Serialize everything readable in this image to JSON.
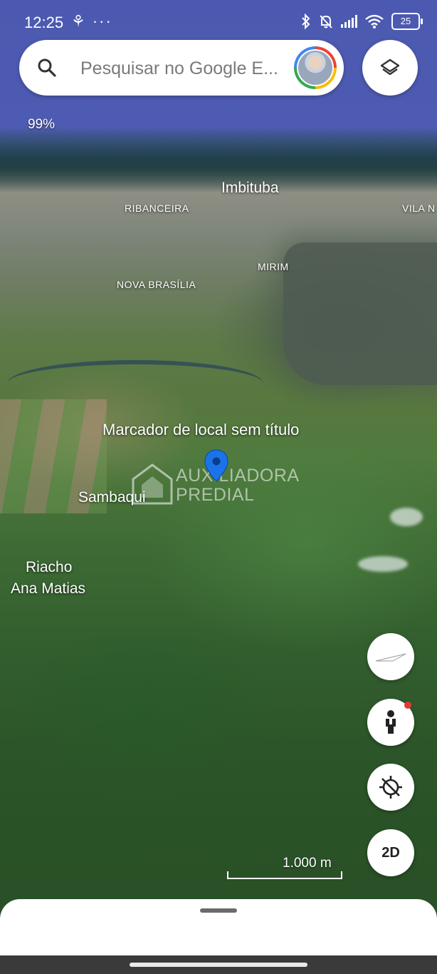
{
  "status_bar": {
    "time": "12:25",
    "misc": "⚘ ···",
    "battery": "25"
  },
  "search": {
    "placeholder": "Pesquisar no Google E..."
  },
  "map": {
    "tilt_readout": "99%",
    "labels": {
      "imbituba": "Imbituba",
      "ribanceira": "RIBANCEIRA",
      "vila_nova": "VILA N",
      "mirim": "MIRIM",
      "nova_brasilia": "NOVA BRASÍLIA",
      "marker": "Marcador de local sem título",
      "sambaqui": "Sambaqui",
      "riacho_line1": "Riacho",
      "riacho_line2": "Ana Matias"
    },
    "watermark": {
      "line1": "AUXILIADORA",
      "line2": "PREDIAL"
    },
    "pin_color": "#1a73e8"
  },
  "controls": {
    "mode_2d": "2D",
    "scale": "1.000 m"
  },
  "icons": [
    "search-icon",
    "layers-icon",
    "compass-icon",
    "pegman-icon",
    "location-off-icon",
    "bluetooth-icon",
    "mute-icon",
    "signal-icon",
    "wifi-icon",
    "battery-icon",
    "map-pin-icon"
  ]
}
